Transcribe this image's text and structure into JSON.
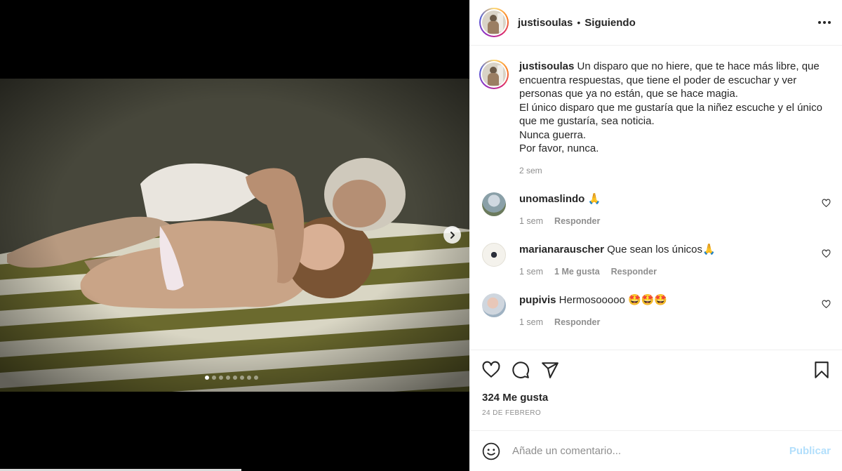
{
  "post": {
    "username": "justisoulas",
    "separator": "•",
    "follow_status": "Siguiendo",
    "carousel_dots": 8,
    "carousel_active": 0
  },
  "caption": {
    "username": "justisoulas",
    "text": " Un disparo que no hiere, que te hace más libre, que encuentra respuestas, que tiene el poder de escuchar y ver personas que ya no están, que se hace magia.",
    "line2": "El único disparo que me gustaría que la niñez escuche y el único que me gustaría, sea noticia.",
    "line3": "Nunca guerra.",
    "line4": "Por favor, nunca.",
    "time": "2 sem"
  },
  "comments": [
    {
      "username": "unomaslindo",
      "text": " 🙏",
      "time": "1 sem",
      "likes": "",
      "reply": "Responder"
    },
    {
      "username": "marianarauscher",
      "text": " Que sean los únicos🙏",
      "time": "1 sem",
      "likes": "1 Me gusta",
      "reply": "Responder"
    },
    {
      "username": "pupivis",
      "text": " Hermosooooo 🤩🤩🤩",
      "time": "1 sem",
      "likes": "",
      "reply": "Responder"
    }
  ],
  "footer": {
    "likes": "324 Me gusta",
    "date": "24 DE FEBRERO",
    "comment_placeholder": "Añade un comentario...",
    "publish_label": "Publicar"
  },
  "icons": {
    "like": "heart-icon",
    "comment": "comment-icon",
    "share": "paper-plane-icon",
    "save": "bookmark-icon",
    "emoji": "smiley-icon",
    "more": "more-dots-icon",
    "next": "chevron-right-icon"
  },
  "colors": {
    "publish_disabled": "#b2dffc",
    "secondary_text": "#8e8e8e",
    "primary_text": "#262626",
    "divider": "#efefef"
  }
}
